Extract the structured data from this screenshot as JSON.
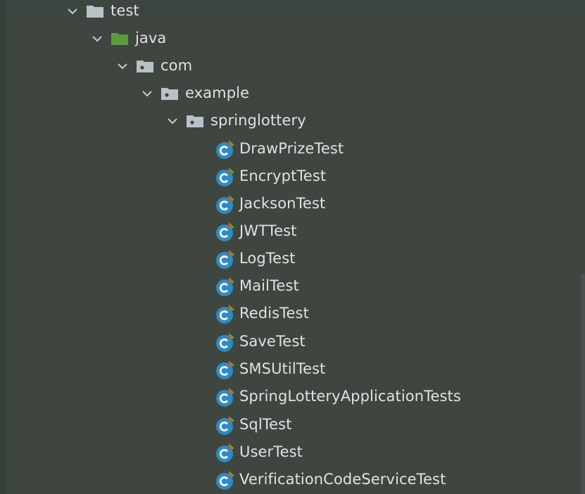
{
  "colors": {
    "background": "#3f4640",
    "text": "#dfe1e5",
    "folder_grey": "#b9c1c9",
    "folder_green": "#5e9b3d",
    "class_icon_blue": "#2f8bc0",
    "class_icon_badge_green": "#58a83a",
    "class_icon_badge_red": "#d94b3f"
  },
  "tree": {
    "folders": [
      {
        "label": "test",
        "icon": "folder-icon"
      },
      {
        "label": "java",
        "icon": "test-sources-folder-icon"
      },
      {
        "label": "com",
        "icon": "package-icon"
      },
      {
        "label": "example",
        "icon": "package-icon"
      },
      {
        "label": "springlottery",
        "icon": "package-icon"
      }
    ],
    "files": [
      {
        "label": "DrawPrizeTest",
        "icon": "test-class-icon"
      },
      {
        "label": "EncryptTest",
        "icon": "test-class-icon"
      },
      {
        "label": "JacksonTest",
        "icon": "test-class-icon"
      },
      {
        "label": "JWTTest",
        "icon": "test-class-icon"
      },
      {
        "label": "LogTest",
        "icon": "test-class-icon"
      },
      {
        "label": "MailTest",
        "icon": "test-class-icon"
      },
      {
        "label": "RedisTest",
        "icon": "test-class-icon"
      },
      {
        "label": "SaveTest",
        "icon": "test-class-icon"
      },
      {
        "label": "SMSUtilTest",
        "icon": "test-class-icon"
      },
      {
        "label": "SpringLotteryApplicationTests",
        "icon": "test-class-icon"
      },
      {
        "label": "SqlTest",
        "icon": "test-class-icon"
      },
      {
        "label": "UserTest",
        "icon": "test-class-icon"
      },
      {
        "label": "VerificationCodeServiceTest",
        "icon": "test-class-icon"
      }
    ]
  }
}
